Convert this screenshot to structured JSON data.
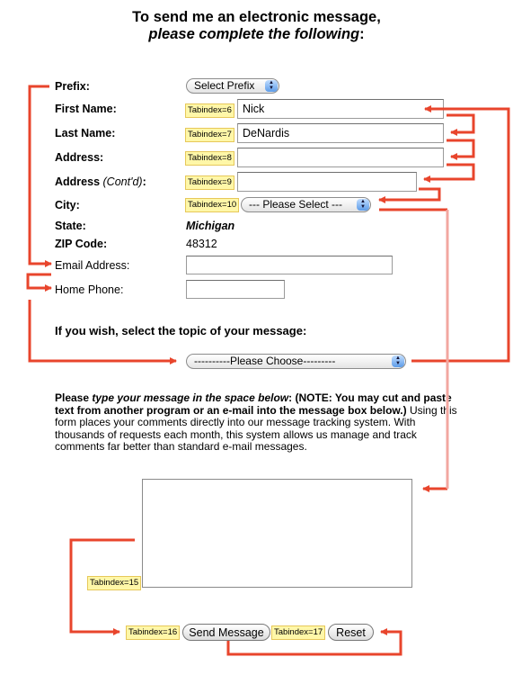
{
  "heading": {
    "line1": "To send me an electronic message,",
    "line2": "please complete the following",
    "line2_colon": ":"
  },
  "form": {
    "prefix": {
      "label": "Prefix:",
      "select_value": "Select Prefix"
    },
    "first_name": {
      "label": "First Name:",
      "tabindex": "Tabindex=6",
      "value": "Nick"
    },
    "last_name": {
      "label": "Last Name:",
      "tabindex": "Tabindex=7",
      "value": "DeNardis"
    },
    "address": {
      "label": "Address:",
      "tabindex": "Tabindex=8",
      "value": ""
    },
    "address2": {
      "label": "Address",
      "label_suffix": "(Cont'd)",
      "label_colon": ":",
      "tabindex": "Tabindex=9",
      "value": ""
    },
    "city": {
      "label": "City:",
      "tabindex": "Tabindex=10",
      "select_value": "--- Please Select ---"
    },
    "state": {
      "label": "State:",
      "value": "Michigan"
    },
    "zip": {
      "label": "ZIP Code:",
      "value": "48312"
    },
    "email": {
      "label": "Email Address:",
      "value": ""
    },
    "phone": {
      "label": "Home Phone:",
      "value": ""
    }
  },
  "topic": {
    "question": "If you wish, select the topic of your message:",
    "select_value": "----------Please Choose---------"
  },
  "instructions": {
    "please": "Please ",
    "type_italic": "type your message in the space below",
    "note": ": (NOTE:  You may cut and paste text from another program or an e-mail into the message box below.)",
    "body": " Using this form places your comments directly into our message tracking system. With thousands of requests each month, this system allows us manage and track comments far better than standard e-mail messages."
  },
  "message": {
    "tabindex": "Tabindex=15",
    "value": ""
  },
  "buttons": {
    "send": {
      "tabindex": "Tabindex=16",
      "label": "Send Message"
    },
    "reset": {
      "tabindex": "Tabindex=17",
      "label": "Reset"
    }
  },
  "annotation_colors": {
    "arrow": "#e8452c",
    "arrow_faded": "#f2a7a0",
    "tab_bg": "#fff7a8"
  }
}
